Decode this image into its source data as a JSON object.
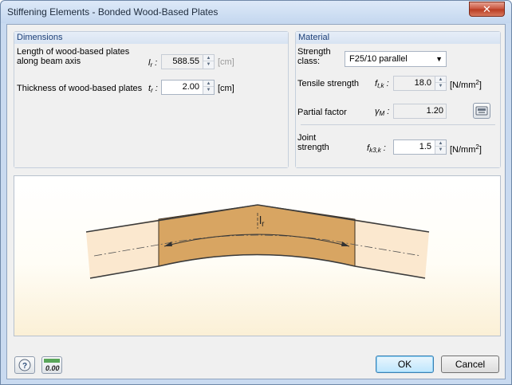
{
  "window": {
    "title": "Stiffening Elements - Bonded Wood-Based Plates",
    "close_label": "✕"
  },
  "dimensions": {
    "header": "Dimensions",
    "length_label_line1": "Length of wood-based plates",
    "length_label_line2": "along beam axis",
    "length_symbol": "l",
    "length_symbol_sub": "r",
    "length_value": "588.55",
    "length_unit": "[cm]",
    "thickness_label": "Thickness of wood-based plates",
    "thickness_symbol": "t",
    "thickness_symbol_sub": "r",
    "thickness_value": "2.00",
    "thickness_unit": "[cm]"
  },
  "material": {
    "header": "Material",
    "strength_class_line1": "Strength",
    "strength_class_line2": "class:",
    "strength_class_value": "F25/10 parallel",
    "tensile_label": "Tensile strength",
    "tensile_symbol": "f",
    "tensile_symbol_sub": "t,k",
    "tensile_value": "18.0",
    "tensile_unit": "[N/mm",
    "tensile_unit_sup": "2",
    "partial_label": "Partial factor",
    "partial_symbol": "γ",
    "partial_symbol_sub": "M",
    "partial_value": "1.20",
    "joint_label_line1": "Joint",
    "joint_label_line2": "strength",
    "joint_symbol": "f",
    "joint_symbol_sub": "k3,k",
    "joint_value": "1.5",
    "joint_unit": "[N/mm",
    "joint_unit_sup": "2",
    "colon": ":"
  },
  "drawing": {
    "dimension_label": "l",
    "dimension_label_sub": "r"
  },
  "buttons": {
    "ok": "OK",
    "cancel": "Cancel",
    "units_icon_text": "0.00"
  },
  "colors": {
    "plate_fill": "#d8a562",
    "beam_fill": "#fbe8cf",
    "accent": "#1c3f78"
  }
}
